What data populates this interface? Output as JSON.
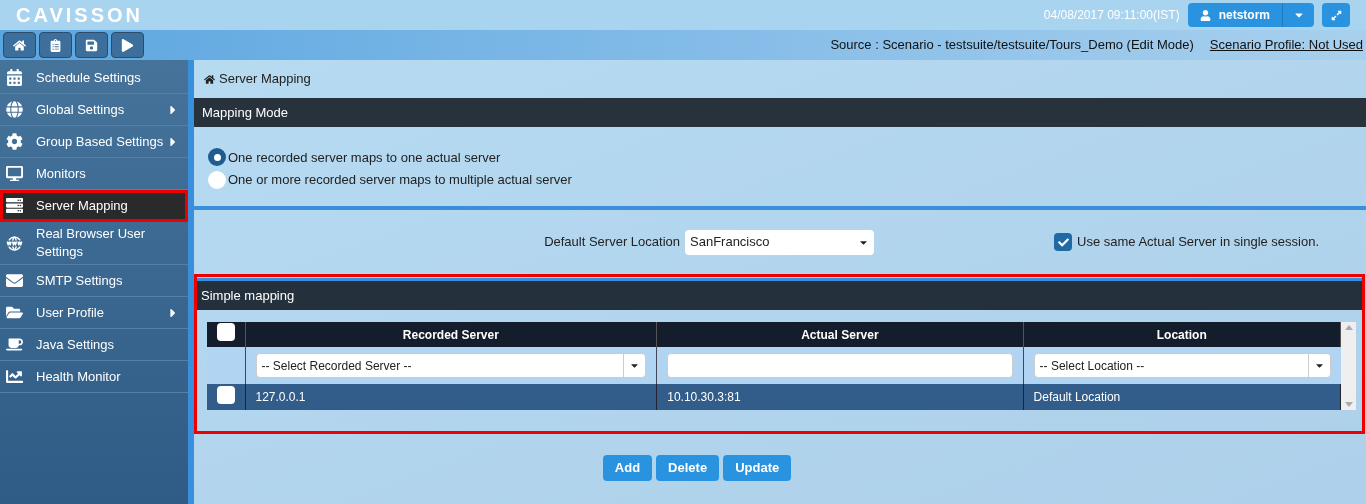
{
  "header": {
    "logo": "CAVISSON",
    "datetime": "04/08/2017 09:11:00(IST)",
    "user": "netstorm"
  },
  "toolbar": {
    "source": "Source : Scenario - testsuite/testsuite/Tours_Demo (Edit Mode)",
    "profile_link": "Scenario Profile: Not Used"
  },
  "sidebar": {
    "items": [
      {
        "label": "Schedule Settings",
        "has_submenu": false,
        "selected": false
      },
      {
        "label": "Global Settings",
        "has_submenu": true,
        "selected": false
      },
      {
        "label": "Group Based Settings",
        "has_submenu": true,
        "selected": false
      },
      {
        "label": "Monitors",
        "has_submenu": false,
        "selected": false
      },
      {
        "label": "Server Mapping",
        "has_submenu": false,
        "selected": true
      },
      {
        "label": "Real Browser User Settings",
        "has_submenu": false,
        "selected": false
      },
      {
        "label": "SMTP Settings",
        "has_submenu": false,
        "selected": false
      },
      {
        "label": "User Profile",
        "has_submenu": true,
        "selected": false
      },
      {
        "label": "Java Settings",
        "has_submenu": false,
        "selected": false
      },
      {
        "label": "Health Monitor",
        "has_submenu": false,
        "selected": false
      }
    ]
  },
  "breadcrumb": "Server Mapping",
  "mapping_mode": {
    "title": "Mapping Mode",
    "options": [
      {
        "label": "One recorded server maps to one actual server",
        "selected": true
      },
      {
        "label": "One or more recorded server maps to multiple actual server",
        "selected": false
      }
    ]
  },
  "settings": {
    "location_label": "Default Server Location",
    "location_value": "SanFrancisco",
    "same_server": {
      "label": "Use same Actual Server in single session.",
      "checked": true
    }
  },
  "simple_mapping": {
    "title": "Simple mapping",
    "highlighted": true,
    "table": {
      "select_all_checked": false,
      "columns": [
        "Recorded Server",
        "Actual Server",
        "Location"
      ],
      "filter_row": {
        "recorded_placeholder": "-- Select Recorded Server --",
        "location_placeholder": "-- Select Location --"
      },
      "rows": [
        {
          "checked": false,
          "cells": [
            "127.0.0.1",
            "10.10.30.3:81",
            "Default Location"
          ]
        }
      ]
    }
  },
  "buttons": [
    "Add",
    "Delete",
    "Update"
  ]
}
